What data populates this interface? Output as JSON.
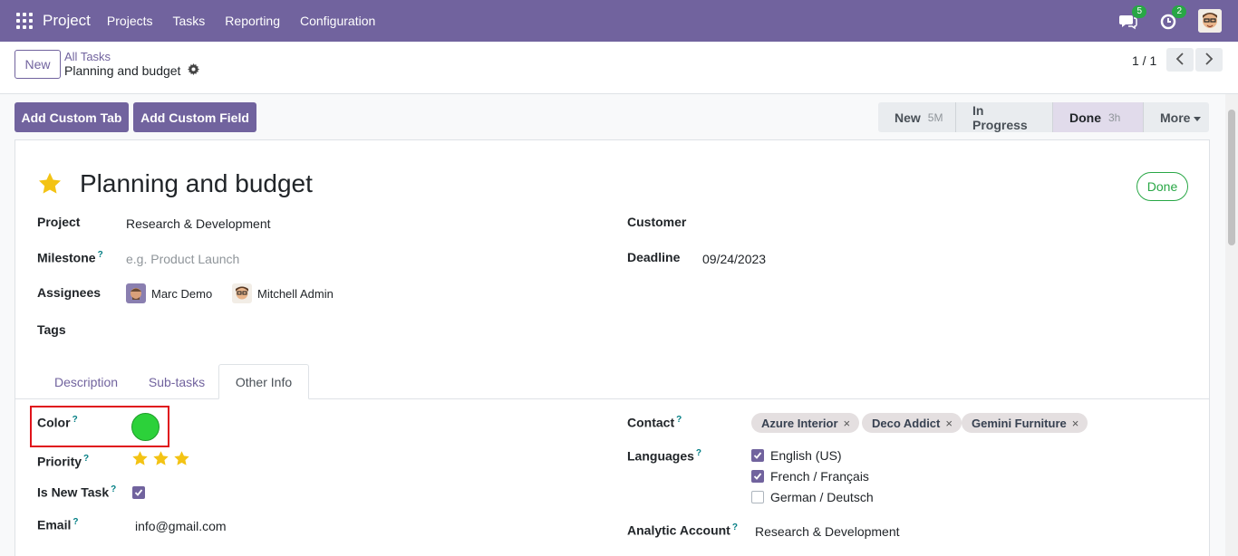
{
  "topbar": {
    "brand": "Project",
    "menu": [
      "Projects",
      "Tasks",
      "Reporting",
      "Configuration"
    ],
    "chat_count": "5",
    "activity_count": "2"
  },
  "control": {
    "new_label": "New",
    "breadcrumb_parent": "All Tasks",
    "breadcrumb_current": "Planning and budget",
    "pager": "1 / 1"
  },
  "actions": {
    "add_custom_tab": "Add Custom Tab",
    "add_custom_field": "Add Custom Field"
  },
  "statusbar": {
    "stages": [
      {
        "label": "New",
        "duration": "5M"
      },
      {
        "label": "In Progress",
        "duration": ""
      },
      {
        "label": "Done",
        "duration": "3h"
      }
    ],
    "more_label": "More"
  },
  "form": {
    "title": "Planning and budget",
    "status_pill": "Done",
    "project_label": "Project",
    "project_value": "Research & Development",
    "milestone_label": "Milestone",
    "milestone_placeholder": "e.g. Product Launch",
    "assignees_label": "Assignees",
    "assignees": [
      "Marc Demo",
      "Mitchell Admin"
    ],
    "tags_label": "Tags",
    "customer_label": "Customer",
    "deadline_label": "Deadline",
    "deadline_value": "09/24/2023",
    "help_mark": "?"
  },
  "tabs": [
    "Description",
    "Sub-tasks",
    "Other Info"
  ],
  "other_info": {
    "color_label": "Color",
    "color_value": "#2cd13a",
    "priority_label": "Priority",
    "priority_stars": 3,
    "is_new_task_label": "Is New Task",
    "is_new_task": true,
    "email_label": "Email",
    "email_value": "info@gmail.com",
    "contact_label": "Contact",
    "contacts": [
      "Azure Interior",
      "Deco Addict",
      "Gemini Furniture"
    ],
    "languages_label": "Languages",
    "languages": [
      {
        "label": "English (US)",
        "checked": true
      },
      {
        "label": "French / Français",
        "checked": true
      },
      {
        "label": "German / Deutsch",
        "checked": false
      }
    ],
    "analytic_account_label": "Analytic Account",
    "analytic_account_value": "Research & Development"
  }
}
